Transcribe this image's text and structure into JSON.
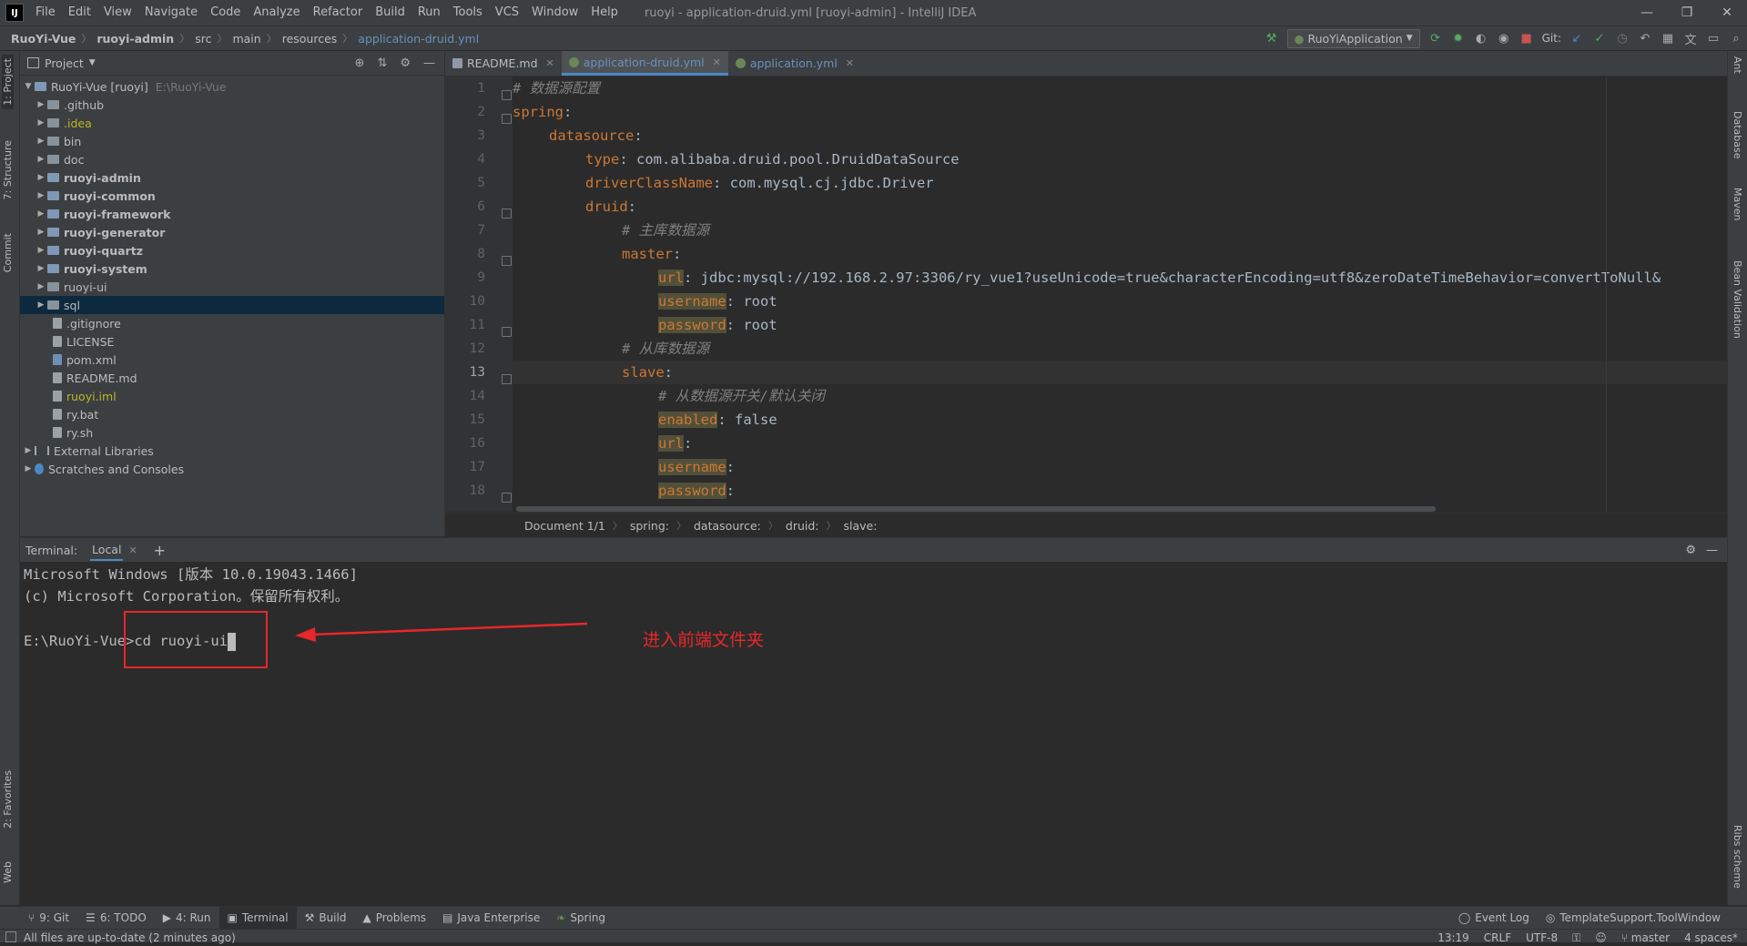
{
  "window": {
    "title": "ruoyi - application-druid.yml [ruoyi-admin] - IntelliJ IDEA",
    "logo": "IJ",
    "controls": [
      "—",
      "❐",
      "✕"
    ]
  },
  "menu": [
    "File",
    "Edit",
    "View",
    "Navigate",
    "Code",
    "Analyze",
    "Refactor",
    "Build",
    "Run",
    "Tools",
    "VCS",
    "Window",
    "Help"
  ],
  "breadcrumb": {
    "project": "RuoYi-Vue",
    "module": "ruoyi-admin",
    "src": "src",
    "main": "main",
    "resources": "resources",
    "file": "application-druid.yml"
  },
  "toolbar": {
    "run_config": "RuoYiApplication",
    "git_label": "Git:"
  },
  "left_stripe": {
    "project": "1: Project",
    "structure": "7: Structure",
    "commit": "Commit",
    "favorites": "2: Favorites",
    "web": "Web"
  },
  "right_stripe": {
    "ant": "Ant",
    "database": "Database",
    "maven": "Maven",
    "bean": "Bean Validation",
    "ribs": "Ribs scheme"
  },
  "project_panel": {
    "title": "Project",
    "root_name": "RuoYi-Vue [ruoyi]",
    "root_path": "E:\\RuoYi-Vue",
    "items": [
      {
        "name": ".github",
        "kind": "folder"
      },
      {
        "name": ".idea",
        "kind": "folder"
      },
      {
        "name": "bin",
        "kind": "folder"
      },
      {
        "name": "doc",
        "kind": "folder"
      },
      {
        "name": "ruoyi-admin",
        "kind": "module"
      },
      {
        "name": "ruoyi-common",
        "kind": "module"
      },
      {
        "name": "ruoyi-framework",
        "kind": "module"
      },
      {
        "name": "ruoyi-generator",
        "kind": "module"
      },
      {
        "name": "ruoyi-quartz",
        "kind": "module"
      },
      {
        "name": "ruoyi-system",
        "kind": "module"
      },
      {
        "name": "ruoyi-ui",
        "kind": "folder"
      },
      {
        "name": "sql",
        "kind": "folder"
      },
      {
        "name": ".gitignore",
        "kind": "file"
      },
      {
        "name": "LICENSE",
        "kind": "file"
      },
      {
        "name": "pom.xml",
        "kind": "file"
      },
      {
        "name": "README.md",
        "kind": "file"
      },
      {
        "name": "ruoyi.iml",
        "kind": "file"
      },
      {
        "name": "ry.bat",
        "kind": "file"
      },
      {
        "name": "ry.sh",
        "kind": "file"
      }
    ],
    "external": "External Libraries",
    "scratches": "Scratches and Consoles"
  },
  "editor": {
    "tabs": [
      "README.md",
      "application-druid.yml",
      "application.yml"
    ],
    "line_numbers": [
      "1",
      "2",
      "3",
      "4",
      "5",
      "6",
      "7",
      "8",
      "9",
      "10",
      "11",
      "12",
      "13",
      "14",
      "15",
      "16",
      "17",
      "18"
    ],
    "lines": {
      "l1": "# 数据源配置",
      "l2_key": "spring",
      "l3_key": "datasource",
      "l4_key": "type",
      "l4_val": " com.alibaba.druid.pool.DruidDataSource",
      "l5_key": "driverClassName",
      "l5_val": " com.mysql.cj.jdbc.Driver",
      "l6_key": "druid",
      "l7": "# 主库数据源",
      "l8_key": "master",
      "l9_key": "url",
      "l9_val": " jdbc:mysql://192.168.2.97:3306/ry_vue1?useUnicode=true&characterEncoding=utf8&zeroDateTimeBehavior=convertToNull&",
      "l10_key": "username",
      "l10_val": " root",
      "l11_key": "password",
      "l11_val": " root",
      "l12": "# 从库数据源",
      "l13_key": "slave",
      "l14": "# 从数据源开关/默认关闭",
      "l15_key": "enabled",
      "l15_val": " false",
      "l16_key": "url",
      "l17_key": "username",
      "l18_key": "password",
      "colon": ":"
    },
    "path": [
      "Document 1/1",
      "spring:",
      "datasource:",
      "druid:",
      "slave:"
    ]
  },
  "terminal": {
    "label": "Terminal:",
    "tab": "Local",
    "line1": "Microsoft Windows [版本 10.0.19043.1466]",
    "line2": "(c) Microsoft Corporation。保留所有权利。",
    "prompt": "E:\\RuoYi-Vue>",
    "command": "cd ruoyi-ui",
    "annotation": "进入前端文件夹"
  },
  "bottom_tools": [
    "9: Git",
    "6: TODO",
    "4: Run",
    "Terminal",
    "Build",
    "Problems",
    "Java Enterprise",
    "Spring"
  ],
  "bottom_right_tools": [
    "Event Log",
    "TemplateSupport.ToolWindow"
  ],
  "status": {
    "message": "All files are up-to-date (2 minutes ago)",
    "position": "13:19",
    "line_sep": "CRLF",
    "encoding": "UTF-8",
    "branch": "master",
    "indent": "4 spaces*"
  },
  "colors": {
    "accent": "#4a88c7",
    "annotation": "#e8272a",
    "keyword": "#cc7832",
    "comment": "#808080"
  }
}
